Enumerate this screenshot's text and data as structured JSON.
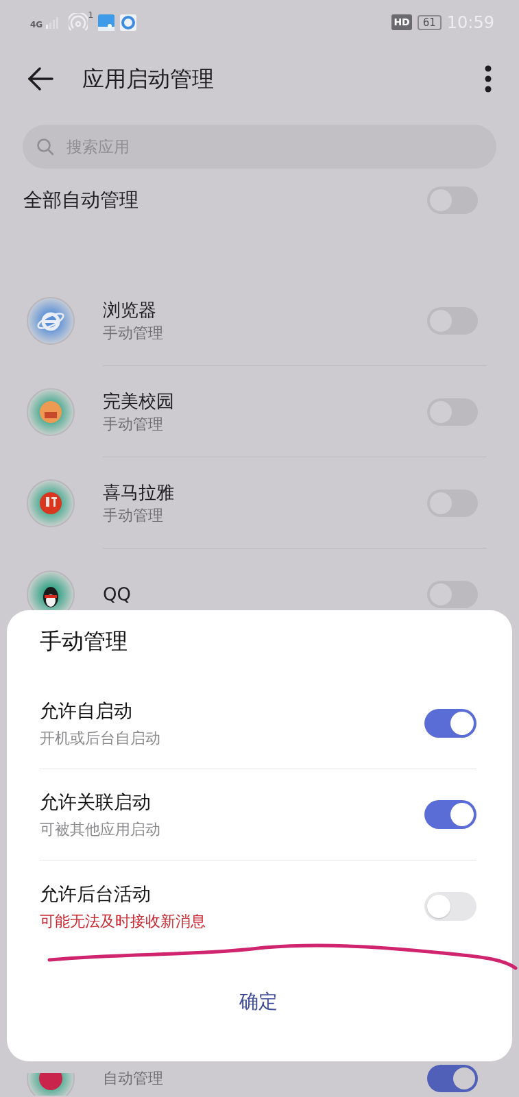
{
  "status_bar": {
    "network": "4G",
    "hotspot_count": "1",
    "hd": "HD",
    "battery": "61",
    "time": "10:59"
  },
  "header": {
    "title": "应用启动管理"
  },
  "search": {
    "placeholder": "搜索应用"
  },
  "auto_all": {
    "label": "全部自动管理",
    "on": false
  },
  "apps": [
    {
      "kind": "globe",
      "name": "浏览器",
      "status": "手动管理",
      "on": false
    },
    {
      "kind": "campus",
      "name": "完美校园",
      "status": "手动管理",
      "on": false
    },
    {
      "kind": "audio",
      "name": "喜马拉雅",
      "status": "手动管理",
      "on": false
    },
    {
      "kind": "penguin",
      "name": "QQ",
      "on": false
    },
    {
      "kind": "rose",
      "status": "自动管理",
      "on": true
    }
  ],
  "dialog": {
    "title": "手动管理",
    "options": [
      {
        "label": "允许自启动",
        "note": "开机或后台自启动",
        "on": true,
        "warning": false
      },
      {
        "label": "允许关联启动",
        "note": "可被其他应用启动",
        "on": true,
        "warning": false
      },
      {
        "label": "允许后台活动",
        "note": "可能无法及时接收新消息",
        "on": false,
        "warning": true
      }
    ],
    "confirm": "确定"
  }
}
